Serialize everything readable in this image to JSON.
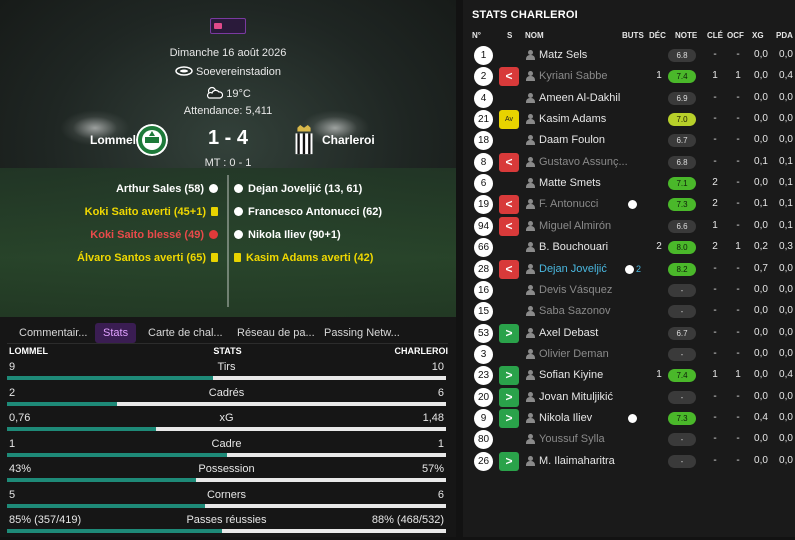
{
  "match": {
    "date": "Dimanche 16 août 2026",
    "stadium": "Soevereinstadion",
    "temperature": "19°C",
    "attendance": "Attendance: 5,411",
    "home": "Lommel",
    "away": "Charleroi",
    "score": "1 - 4",
    "halftime": "MT : 0 - 1"
  },
  "events": {
    "home": [
      {
        "text": "Arthur Sales (58)",
        "type": "goal",
        "color": "#ffffff"
      },
      {
        "text": "Koki Saito averti (45+1)",
        "type": "yellow",
        "color": "#f0d800"
      },
      {
        "text": "Koki Saito blessé (49)",
        "type": "injury",
        "color": "#e84a4a"
      },
      {
        "text": "Álvaro Santos averti (65)",
        "type": "yellow",
        "color": "#f0d800"
      }
    ],
    "away": [
      {
        "text": "Dejan Joveljić (13, 61)",
        "type": "goal",
        "color": "#ffffff"
      },
      {
        "text": "Francesco Antonucci (62)",
        "type": "goal",
        "color": "#ffffff"
      },
      {
        "text": "Nikola Iliev (90+1)",
        "type": "goal",
        "color": "#ffffff"
      },
      {
        "text": "Kasim Adams averti (42)",
        "type": "yellow",
        "color": "#f0d800"
      }
    ]
  },
  "tabs": [
    "Commentair...",
    "Stats",
    "Carte de chal...",
    "Réseau de pa...",
    "Passing Netw..."
  ],
  "active_tab": "Stats",
  "stats_header": {
    "home": "LOMMEL",
    "middle": "STATS",
    "away": "CHARLEROI"
  },
  "stats": [
    {
      "name": "Tirs",
      "home": "9",
      "away": "10",
      "home_share": 0.47
    },
    {
      "name": "Cadrés",
      "home": "2",
      "away": "6",
      "home_share": 0.25
    },
    {
      "name": "xG",
      "home": "0,76",
      "away": "1,48",
      "home_share": 0.34
    },
    {
      "name": "Cadre",
      "home": "1",
      "away": "1",
      "home_share": 0.5
    },
    {
      "name": "Possession",
      "home": "43%",
      "away": "57%",
      "home_share": 0.43
    },
    {
      "name": "Corners",
      "home": "5",
      "away": "6",
      "home_share": 0.45
    },
    {
      "name": "Passes réussies",
      "home": "85% (357/419)",
      "away": "88% (468/532)",
      "home_share": 0.49
    }
  ],
  "right_panel": {
    "title": "STATS CHARLEROI",
    "columns": [
      "N°",
      "S",
      "NOM",
      "BUTS",
      "DÉC",
      "NOTE",
      "CLÉ",
      "OCF",
      "XG",
      "PDA"
    ]
  },
  "players": [
    {
      "num": "1",
      "sub": "",
      "name": "Matz Sels",
      "style": "normal",
      "goals": "",
      "dec": "",
      "note": "6.8",
      "note_style": "g",
      "cle": "-",
      "ocf": "-",
      "xg": "0,0",
      "pda": "0,0"
    },
    {
      "num": "2",
      "sub": "out",
      "name": "Kyriani Sabbe",
      "style": "dim",
      "goals": "",
      "dec": "1",
      "note": "7.4",
      "note_style": "gr",
      "cle": "1",
      "ocf": "1",
      "xg": "0,0",
      "pda": "0,4"
    },
    {
      "num": "4",
      "sub": "",
      "name": "Ameen Al-Dakhil",
      "style": "normal",
      "goals": "",
      "dec": "",
      "note": "6.9",
      "note_style": "g",
      "cle": "-",
      "ocf": "-",
      "xg": "0,0",
      "pda": "0,0"
    },
    {
      "num": "21",
      "sub": "av",
      "name": "Kasim Adams",
      "style": "normal",
      "goals": "",
      "dec": "",
      "note": "7.0",
      "note_style": "y",
      "cle": "-",
      "ocf": "-",
      "xg": "0,0",
      "pda": "0,0"
    },
    {
      "num": "18",
      "sub": "",
      "name": "Daam Foulon",
      "style": "normal",
      "goals": "",
      "dec": "",
      "note": "6.7",
      "note_style": "g",
      "cle": "-",
      "ocf": "-",
      "xg": "0,0",
      "pda": "0,0"
    },
    {
      "num": "8",
      "sub": "out",
      "name": "Gustavo Assunç...",
      "style": "dim",
      "goals": "",
      "dec": "",
      "note": "6.8",
      "note_style": "g",
      "cle": "-",
      "ocf": "-",
      "xg": "0,1",
      "pda": "0,1"
    },
    {
      "num": "6",
      "sub": "",
      "name": "Matte Smets",
      "style": "normal",
      "goals": "",
      "dec": "",
      "note": "7.1",
      "note_style": "gr",
      "cle": "2",
      "ocf": "-",
      "xg": "0,0",
      "pda": "0,1"
    },
    {
      "num": "19",
      "sub": "out",
      "name": "F. Antonucci",
      "style": "dim",
      "goals": "ball",
      "dec": "",
      "note": "7.3",
      "note_style": "gr",
      "cle": "2",
      "ocf": "-",
      "xg": "0,1",
      "pda": "0,1"
    },
    {
      "num": "94",
      "sub": "out",
      "name": "Miguel Almirón",
      "style": "dim",
      "goals": "",
      "dec": "",
      "note": "6.6",
      "note_style": "g",
      "cle": "1",
      "ocf": "-",
      "xg": "0,0",
      "pda": "0,1"
    },
    {
      "num": "66",
      "sub": "",
      "name": "B. Bouchouari",
      "style": "normal",
      "goals": "",
      "dec": "2",
      "note": "8.0",
      "note_style": "gr",
      "cle": "2",
      "ocf": "1",
      "xg": "0,2",
      "pda": "0,3"
    },
    {
      "num": "28",
      "sub": "out",
      "name": "Dejan Joveljić",
      "style": "hl",
      "goals": "ball2",
      "dec": "",
      "note": "8.2",
      "note_style": "gr",
      "cle": "-",
      "ocf": "-",
      "xg": "0,7",
      "pda": "0,0"
    },
    {
      "num": "16",
      "sub": "",
      "name": "Devis Vásquez",
      "style": "dim",
      "goals": "",
      "dec": "",
      "note": "-",
      "note_style": "d",
      "cle": "-",
      "ocf": "-",
      "xg": "0,0",
      "pda": "0,0"
    },
    {
      "num": "15",
      "sub": "",
      "name": "Saba Sazonov",
      "style": "dim",
      "goals": "",
      "dec": "",
      "note": "-",
      "note_style": "d",
      "cle": "-",
      "ocf": "-",
      "xg": "0,0",
      "pda": "0,0"
    },
    {
      "num": "53",
      "sub": "in",
      "name": "Axel Debast",
      "style": "normal",
      "goals": "",
      "dec": "",
      "note": "6.7",
      "note_style": "g",
      "cle": "-",
      "ocf": "-",
      "xg": "0,0",
      "pda": "0,0"
    },
    {
      "num": "3",
      "sub": "",
      "name": "Olivier Deman",
      "style": "dim",
      "goals": "",
      "dec": "",
      "note": "-",
      "note_style": "d",
      "cle": "-",
      "ocf": "-",
      "xg": "0,0",
      "pda": "0,0"
    },
    {
      "num": "23",
      "sub": "in",
      "name": "Sofian Kiyine",
      "style": "normal",
      "goals": "",
      "dec": "1",
      "note": "7.4",
      "note_style": "gr",
      "cle": "1",
      "ocf": "1",
      "xg": "0,0",
      "pda": "0,4"
    },
    {
      "num": "20",
      "sub": "in",
      "name": "Jovan Mituljikić",
      "style": "normal",
      "goals": "",
      "dec": "",
      "note": "-",
      "note_style": "d",
      "cle": "-",
      "ocf": "-",
      "xg": "0,0",
      "pda": "0,0"
    },
    {
      "num": "9",
      "sub": "in",
      "name": "Nikola Iliev",
      "style": "normal",
      "goals": "ball",
      "dec": "",
      "note": "7.3",
      "note_style": "gr",
      "cle": "-",
      "ocf": "-",
      "xg": "0,4",
      "pda": "0,0"
    },
    {
      "num": "80",
      "sub": "",
      "name": "Youssuf Sylla",
      "style": "dim",
      "goals": "",
      "dec": "",
      "note": "-",
      "note_style": "d",
      "cle": "-",
      "ocf": "-",
      "xg": "0,0",
      "pda": "0,0"
    },
    {
      "num": "26",
      "sub": "in",
      "name": "M. Ilaimaharitra",
      "style": "normal",
      "goals": "",
      "dec": "",
      "note": "-",
      "note_style": "d",
      "cle": "-",
      "ocf": "-",
      "xg": "0,0",
      "pda": "0,0"
    }
  ],
  "goal_count_badge": "2",
  "sub_symbols": {
    "out": "<",
    "in": ">",
    "av": "Av"
  }
}
